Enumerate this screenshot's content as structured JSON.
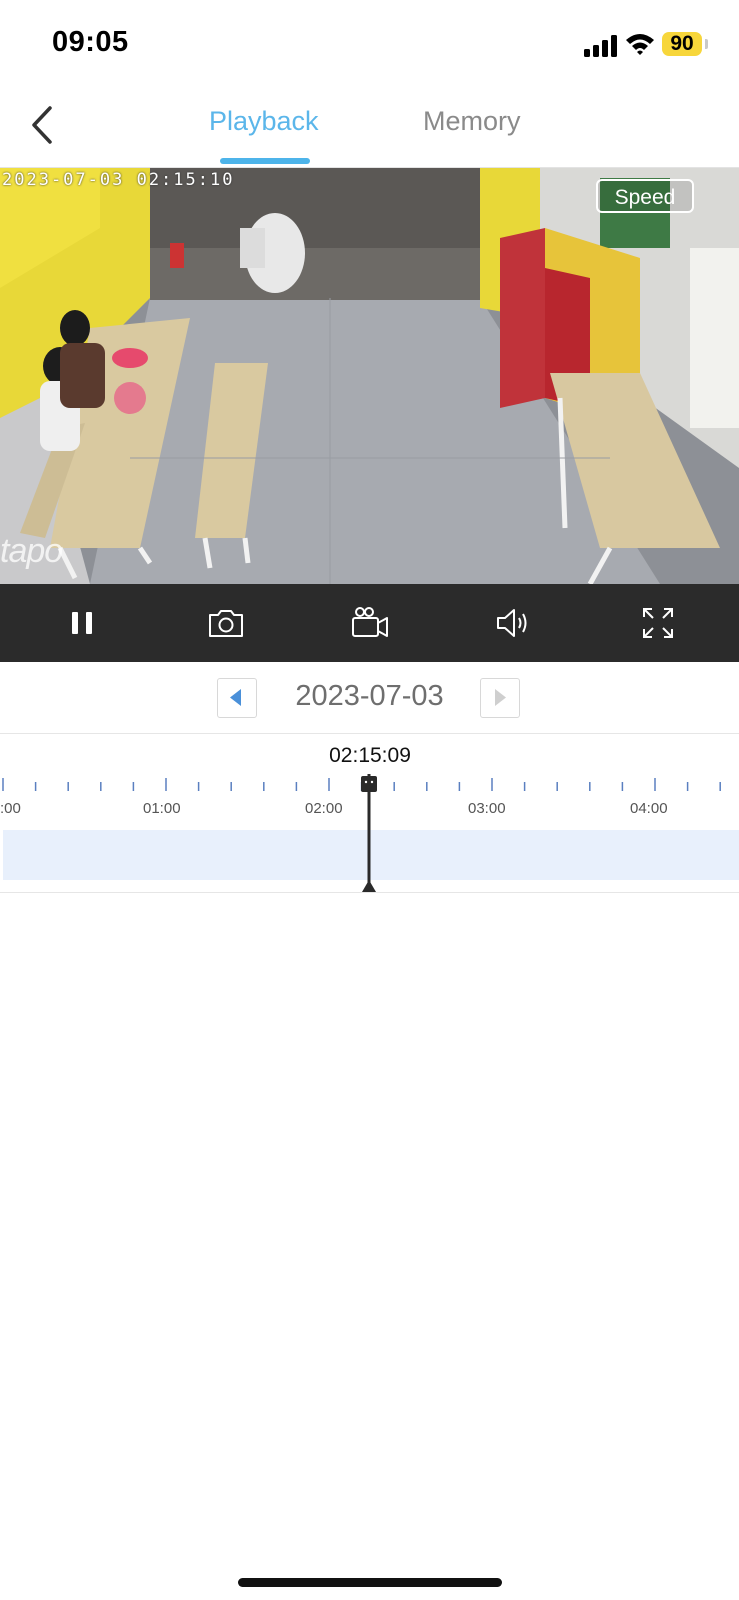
{
  "status_bar": {
    "time": "09:05",
    "battery": "90"
  },
  "nav": {
    "tabs": [
      {
        "label": "Playback",
        "active": true
      },
      {
        "label": "Memory",
        "active": false
      }
    ]
  },
  "video": {
    "timestamp": "2023-07-03  02:15:10",
    "speed_label": "Speed",
    "watermark": "tapo"
  },
  "controls": [
    "pause-icon",
    "camera-icon",
    "record-icon",
    "speaker-icon",
    "fullscreen-icon"
  ],
  "date_nav": {
    "date": "2023-07-03"
  },
  "timeline": {
    "cursor_time": "02:15:09",
    "tick_labels": [
      ":00",
      "01:00",
      "02:00",
      "03:00",
      "04:00"
    ]
  },
  "colors": {
    "accent": "#4db4ea",
    "controls_bg": "#2b2b2b",
    "recording_band": "#e8f0fc",
    "battery": "#f7d63b"
  }
}
